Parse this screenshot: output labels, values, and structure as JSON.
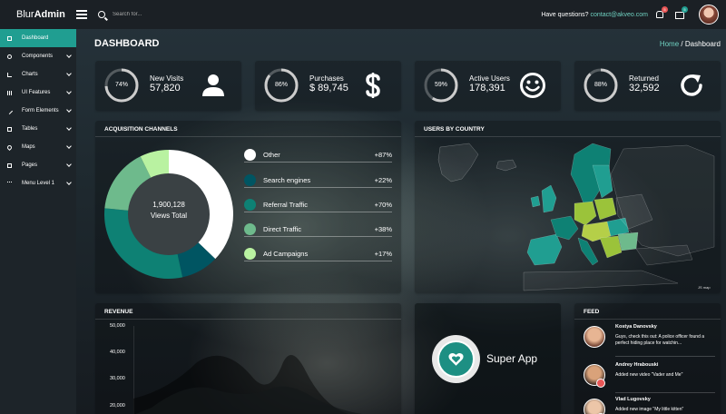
{
  "app": {
    "logo_light": "Blur",
    "logo_bold": "Admin",
    "search_placeholder": "Search for...",
    "questions_text": "Have questions?",
    "questions_email": "contact@akveo.com",
    "notifications_count": "5",
    "messages_count": "5"
  },
  "sidebar": {
    "items": [
      {
        "label": "Dashboard",
        "icon": "home-icon"
      },
      {
        "label": "Components",
        "icon": "gear-icon"
      },
      {
        "label": "Charts",
        "icon": "chart-icon"
      },
      {
        "label": "UI Features",
        "icon": "grid-icon"
      },
      {
        "label": "Form Elements",
        "icon": "pencil-icon"
      },
      {
        "label": "Tables",
        "icon": "table-icon"
      },
      {
        "label": "Maps",
        "icon": "map-pin-icon"
      },
      {
        "label": "Pages",
        "icon": "file-icon"
      },
      {
        "label": "Menu Level 1",
        "icon": "dots-icon"
      }
    ]
  },
  "header": {
    "title": "DASHBOARD",
    "breadcrumb_home": "Home",
    "breadcrumb_sep": "/",
    "breadcrumb_current": "Dashboard"
  },
  "stats": [
    {
      "percent_label": "74%",
      "percent": 74,
      "label": "New Visits",
      "value": "57,820",
      "icon": "person-icon"
    },
    {
      "percent_label": "86%",
      "percent": 86,
      "label": "Purchases",
      "value": "$ 89,745",
      "icon": "dollar-icon"
    },
    {
      "percent_label": "59%",
      "percent": 59,
      "label": "Active Users",
      "value": "178,391",
      "icon": "smile-icon"
    },
    {
      "percent_label": "88%",
      "percent": 88,
      "label": "Returned",
      "value": "32,592",
      "icon": "refresh-icon"
    }
  ],
  "acquisition": {
    "title": "ACQUISITION CHANNELS",
    "center_value": "1,900,128",
    "center_label": "Views Total",
    "channels": [
      {
        "name": "Other",
        "value": "+87%",
        "color": "#ffffff"
      },
      {
        "name": "Search engines",
        "value": "+22%",
        "color": "#005562"
      },
      {
        "name": "Referral Traffic",
        "value": "+70%",
        "color": "#0e8174"
      },
      {
        "name": "Direct Traffic",
        "value": "+38%",
        "color": "#6eba8c"
      },
      {
        "name": "Ad Campaigns",
        "value": "+17%",
        "color": "#b9f2a1"
      }
    ]
  },
  "map": {
    "title": "USERS BY COUNTRY",
    "credit": "JS map"
  },
  "revenue": {
    "title": "REVENUE",
    "y_ticks": [
      "50,000",
      "40,000",
      "30,000",
      "20,000"
    ]
  },
  "app_promo": {
    "label": "Super App"
  },
  "feed": {
    "title": "FEED",
    "items": [
      {
        "name": "Kostya Danovsky",
        "text": "Guys, check this out: A police officer found a perfect hiding place for watchin..."
      },
      {
        "name": "Andrey Hrabouski",
        "text": "Added new video \"Vader and Me\""
      },
      {
        "name": "Vlad Lugovsky",
        "text": "Added new image \"My little kitten\""
      }
    ]
  },
  "colors": {
    "accent": "#209e91",
    "link": "#6fd1c1"
  }
}
